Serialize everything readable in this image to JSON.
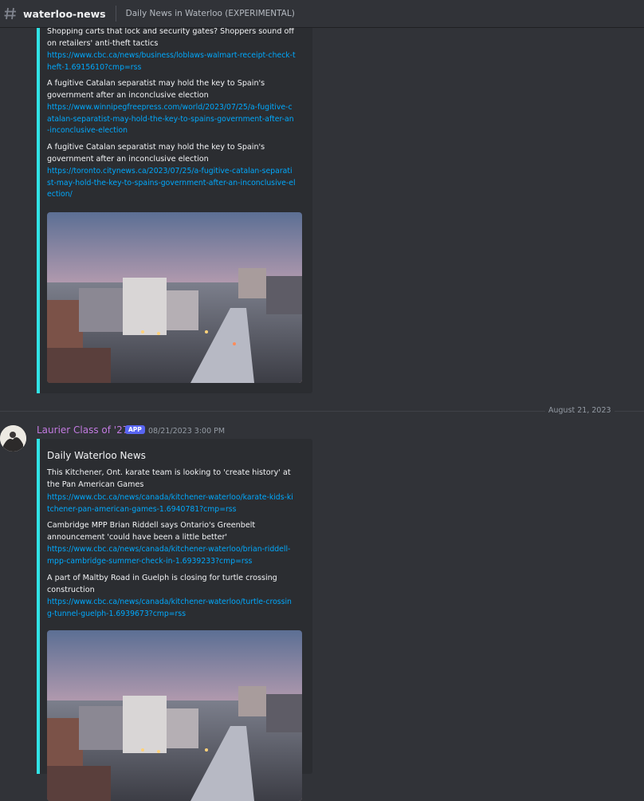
{
  "channel": {
    "name": "waterloo-news",
    "topic": "Daily News in Waterloo (EXPERIMENTAL)"
  },
  "embed_prev": {
    "items": [
      {
        "title": "Shopping carts that lock and security gates? Shoppers sound off on retailers' anti-theft tactics",
        "link": "https://www.cbc.ca/news/business/loblaws-walmart-receipt-check-theft-1.6915610?cmp=rss"
      },
      {
        "title": "A fugitive Catalan separatist may hold the key to Spain's government after an inconclusive election",
        "link": "https://www.winnipegfreepress.com/world/2023/07/25/a-fugitive-catalan-separatist-may-hold-the-key-to-spains-government-after-an-inconclusive-election"
      },
      {
        "title": "A fugitive Catalan separatist may hold the key to Spain's government after an inconclusive election",
        "link": "https://toronto.citynews.ca/2023/07/25/a-fugitive-catalan-separatist-may-hold-the-key-to-spains-government-after-an-inconclusive-election/"
      }
    ]
  },
  "date_divider": "August 21, 2023",
  "message": {
    "author": "Laurier Class of '27",
    "badge": "APP",
    "timestamp": "08/21/2023 3:00 PM",
    "embed": {
      "title": "Daily Waterloo News",
      "items": [
        {
          "title": "This Kitchener, Ont. karate team is looking to 'create history' at the Pan American Games",
          "link": "https://www.cbc.ca/news/canada/kitchener-waterloo/karate-kids-kitchener-pan-american-games-1.6940781?cmp=rss"
        },
        {
          "title": "Cambridge MPP Brian Riddell says Ontario's Greenbelt announcement 'could have been a little better'",
          "link": "https://www.cbc.ca/news/canada/kitchener-waterloo/brian-riddell-mpp-cambridge-summer-check-in-1.6939233?cmp=rss"
        },
        {
          "title": "A part of Maltby Road in Guelph is closing for turtle crossing construction",
          "link": "https://www.cbc.ca/news/canada/kitchener-waterloo/turtle-crossing-tunnel-guelph-1.6939673?cmp=rss"
        }
      ]
    }
  },
  "colors": {
    "background": "#313338",
    "embed_bg": "#2b2d31",
    "embed_accent": "#31e3e6",
    "link": "#00a8fc",
    "author": "#c27ae0",
    "badge": "#5865f2"
  }
}
